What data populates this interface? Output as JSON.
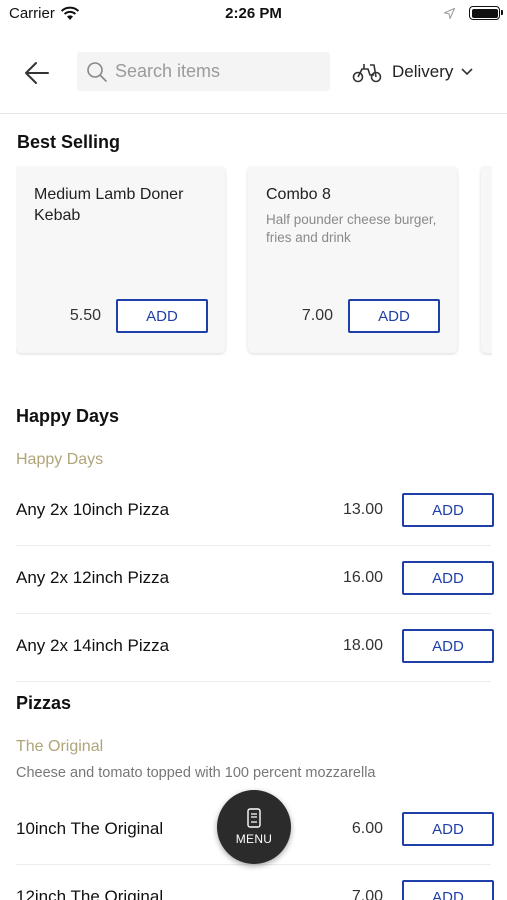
{
  "status_bar": {
    "carrier": "Carrier",
    "time": "2:26 PM"
  },
  "header": {
    "search_placeholder": "Search items",
    "delivery_label": "Delivery"
  },
  "best_selling": {
    "title": "Best Selling",
    "cards": [
      {
        "name": "Medium Lamb Doner Kebab",
        "description": "",
        "price": "5.50",
        "add_label": "ADD"
      },
      {
        "name": "Combo 8",
        "description": "Half pounder cheese burger, fries and drink",
        "price": "7.00",
        "add_label": "ADD"
      }
    ]
  },
  "categories": [
    {
      "title": "Happy Days",
      "subtitle": "Happy Days",
      "note": "",
      "items": [
        {
          "name": "Any 2x 10inch Pizza",
          "price": "13.00",
          "add_label": "ADD"
        },
        {
          "name": "Any 2x 12inch Pizza",
          "price": "16.00",
          "add_label": "ADD"
        },
        {
          "name": "Any 2x 14inch Pizza",
          "price": "18.00",
          "add_label": "ADD"
        }
      ]
    },
    {
      "title": "Pizzas",
      "subtitle": "The Original",
      "note": "Cheese and tomato topped with 100 percent mozzarella",
      "items": [
        {
          "name": "10inch The Original",
          "price": "6.00",
          "add_label": "ADD"
        },
        {
          "name": "12inch The Original",
          "price": "7.00",
          "add_label": "ADD"
        }
      ]
    }
  ],
  "menu_button": {
    "label": "MENU"
  },
  "colors": {
    "accent": "#1f3fa8",
    "subtitle": "#b0a47a",
    "fab": "#2b2b2b"
  },
  "icons": [
    "wifi-icon",
    "location-arrow-icon",
    "battery-icon",
    "back-arrow-icon",
    "search-icon",
    "scooter-icon",
    "chevron-down-icon",
    "menu-book-icon"
  ]
}
